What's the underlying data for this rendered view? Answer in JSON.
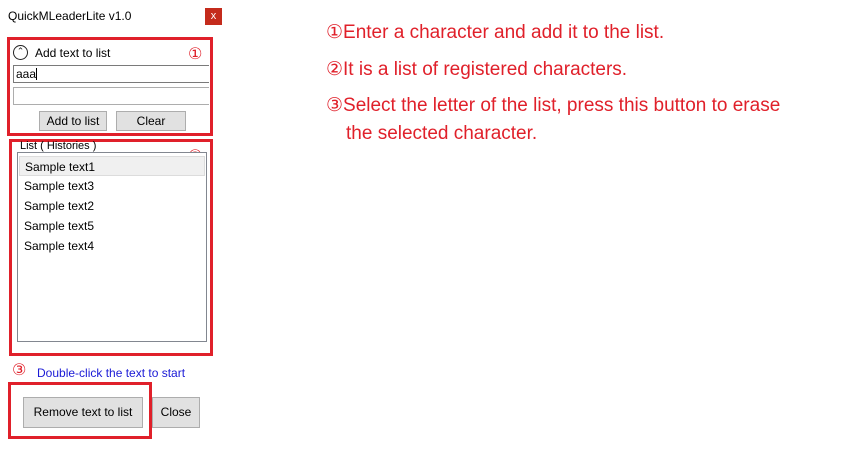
{
  "window": {
    "title": "QuickMLeaderLite v1.0",
    "close_glyph": "x"
  },
  "add_section": {
    "expander_glyph": "⌃",
    "label": "Add text to list",
    "input_value": "aaa",
    "input2_value": "",
    "add_button": "Add to list",
    "clear_button": "Clear"
  },
  "list_section": {
    "group_label": "List ( Histories )",
    "items": [
      "Sample text1",
      "Sample text3",
      "Sample text2",
      "Sample text5",
      "Sample text4"
    ]
  },
  "hint": "Double-click the text to start",
  "bottom": {
    "remove_button": "Remove text to list",
    "close_button": "Close"
  },
  "annotations": {
    "marker1": "①",
    "marker2": "②",
    "marker3": "③",
    "note1": "①Enter a character and add it to the list.",
    "note2": "②It is a list of registered characters.",
    "note3_line1": "③Select the letter of the list, press this button to erase",
    "note3_line2": "the selected character."
  },
  "colors": {
    "annotation_red": "#e0202a",
    "hint_blue": "#1a1ad6",
    "close_red": "#c42b1c"
  }
}
